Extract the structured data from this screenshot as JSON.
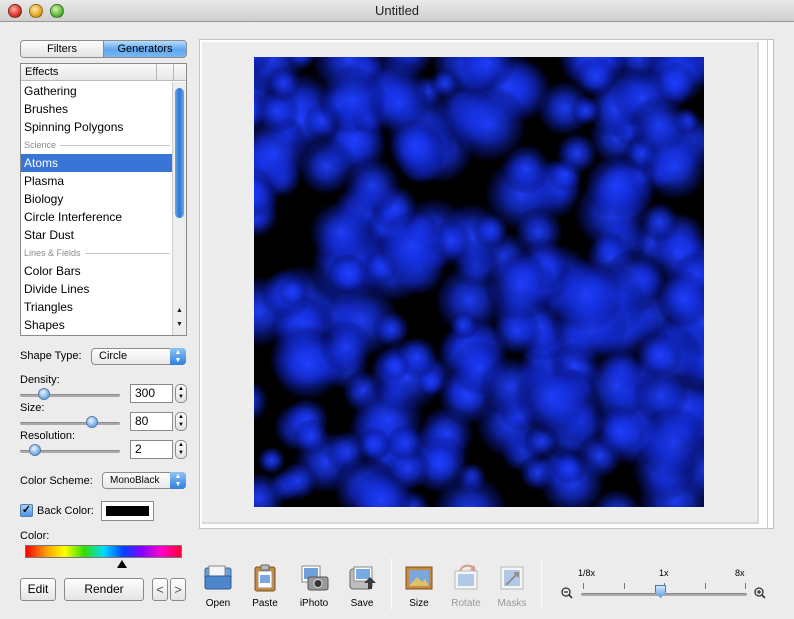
{
  "window": {
    "title": "Untitled"
  },
  "mode_tabs": [
    {
      "label": "Filters",
      "active": false
    },
    {
      "label": "Generators",
      "active": true
    }
  ],
  "effects_list": {
    "header": "Effects",
    "rows": [
      {
        "type": "item",
        "label": "Gathering"
      },
      {
        "type": "item",
        "label": "Brushes"
      },
      {
        "type": "item",
        "label": "Spinning Polygons"
      },
      {
        "type": "section",
        "label": "Science"
      },
      {
        "type": "item",
        "label": "Atoms",
        "selected": true
      },
      {
        "type": "item",
        "label": "Plasma"
      },
      {
        "type": "item",
        "label": "Biology"
      },
      {
        "type": "item",
        "label": "Circle Interference"
      },
      {
        "type": "item",
        "label": "Star Dust"
      },
      {
        "type": "section",
        "label": "Lines & Fields"
      },
      {
        "type": "item",
        "label": "Color Bars"
      },
      {
        "type": "item",
        "label": "Divide Lines"
      },
      {
        "type": "item",
        "label": "Triangles"
      },
      {
        "type": "item",
        "label": "Shapes"
      }
    ]
  },
  "shape_type": {
    "label": "Shape Type:",
    "value": "Circle"
  },
  "density": {
    "label": "Density:",
    "value": "300",
    "level": 0.2
  },
  "size": {
    "label": "Size:",
    "value": "80",
    "level": 0.75
  },
  "resolution": {
    "label": "Resolution:",
    "value": "2",
    "level": 0.1
  },
  "color_scheme": {
    "label": "Color Scheme:",
    "value": "MonoBlack"
  },
  "back_color": {
    "label": "Back Color:",
    "checked": true,
    "color": "#000000"
  },
  "color": {
    "label": "Color:",
    "selected_hue_position": 0.62
  },
  "buttons": {
    "edit": "Edit",
    "render": "Render",
    "prev": "<",
    "next": ">"
  },
  "toolbar": [
    {
      "label": "Open",
      "icon": "open-icon",
      "enabled": true
    },
    {
      "label": "Paste",
      "icon": "paste-icon",
      "enabled": true
    },
    {
      "label": "iPhoto",
      "icon": "iphoto-icon",
      "enabled": true
    },
    {
      "label": "Save",
      "icon": "save-icon",
      "enabled": true
    },
    {
      "label": "Size",
      "icon": "size-icon",
      "enabled": true
    },
    {
      "label": "Rotate",
      "icon": "rotate-icon",
      "enabled": false
    },
    {
      "label": "Masks",
      "icon": "masks-icon",
      "enabled": false
    }
  ],
  "zoom": {
    "labels": [
      "1/8x",
      "1x",
      "8x"
    ],
    "current": "1x"
  },
  "colors": {
    "accent": "#3875d7",
    "atom": "#1a3cff",
    "canvas_bg": "#000000"
  }
}
